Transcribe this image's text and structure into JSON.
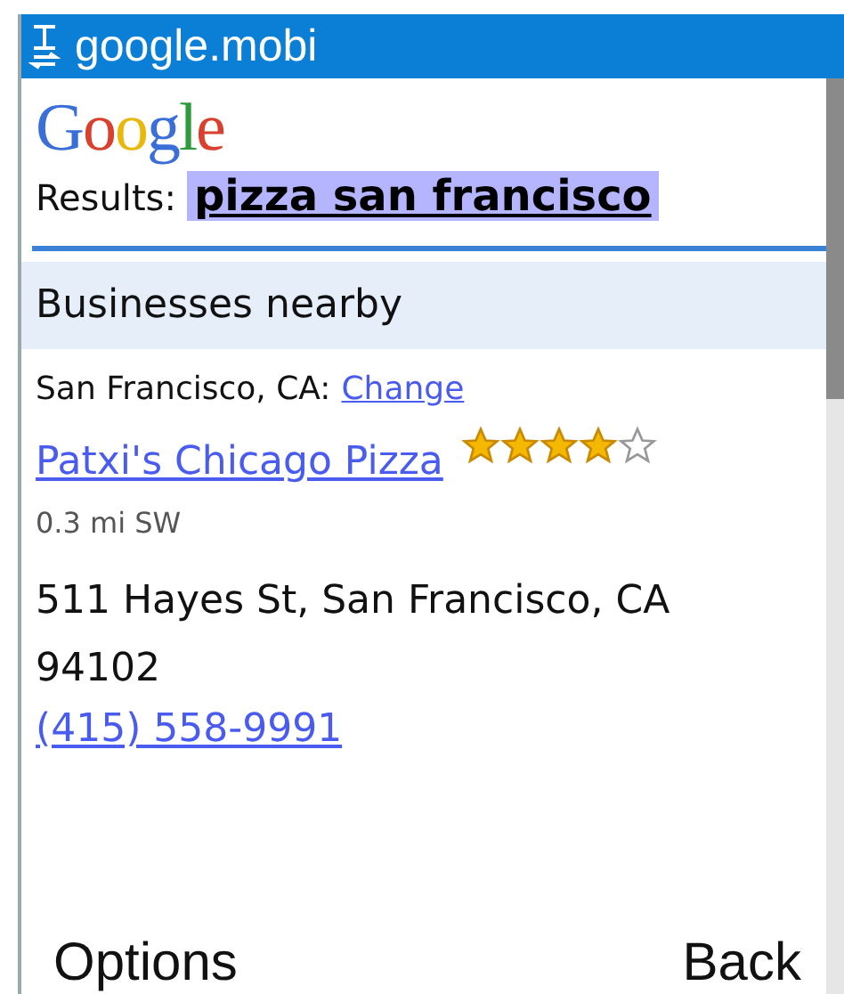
{
  "window": {
    "title": "google.mobi"
  },
  "logo": "Google",
  "query": {
    "label": "Results:",
    "text": "pizza san francisco"
  },
  "section": {
    "title": "Businesses nearby"
  },
  "location": {
    "text": "San Francisco, CA:",
    "link": "Change"
  },
  "result": {
    "name": "Patxi's Chicago Pizza",
    "stars": 4,
    "distance": "0.3 mi SW",
    "address": "511 Hayes St, San Francisco, CA 94102",
    "phone": "(415) 558-9991"
  },
  "softkeys": [
    "Options",
    "Back"
  ]
}
